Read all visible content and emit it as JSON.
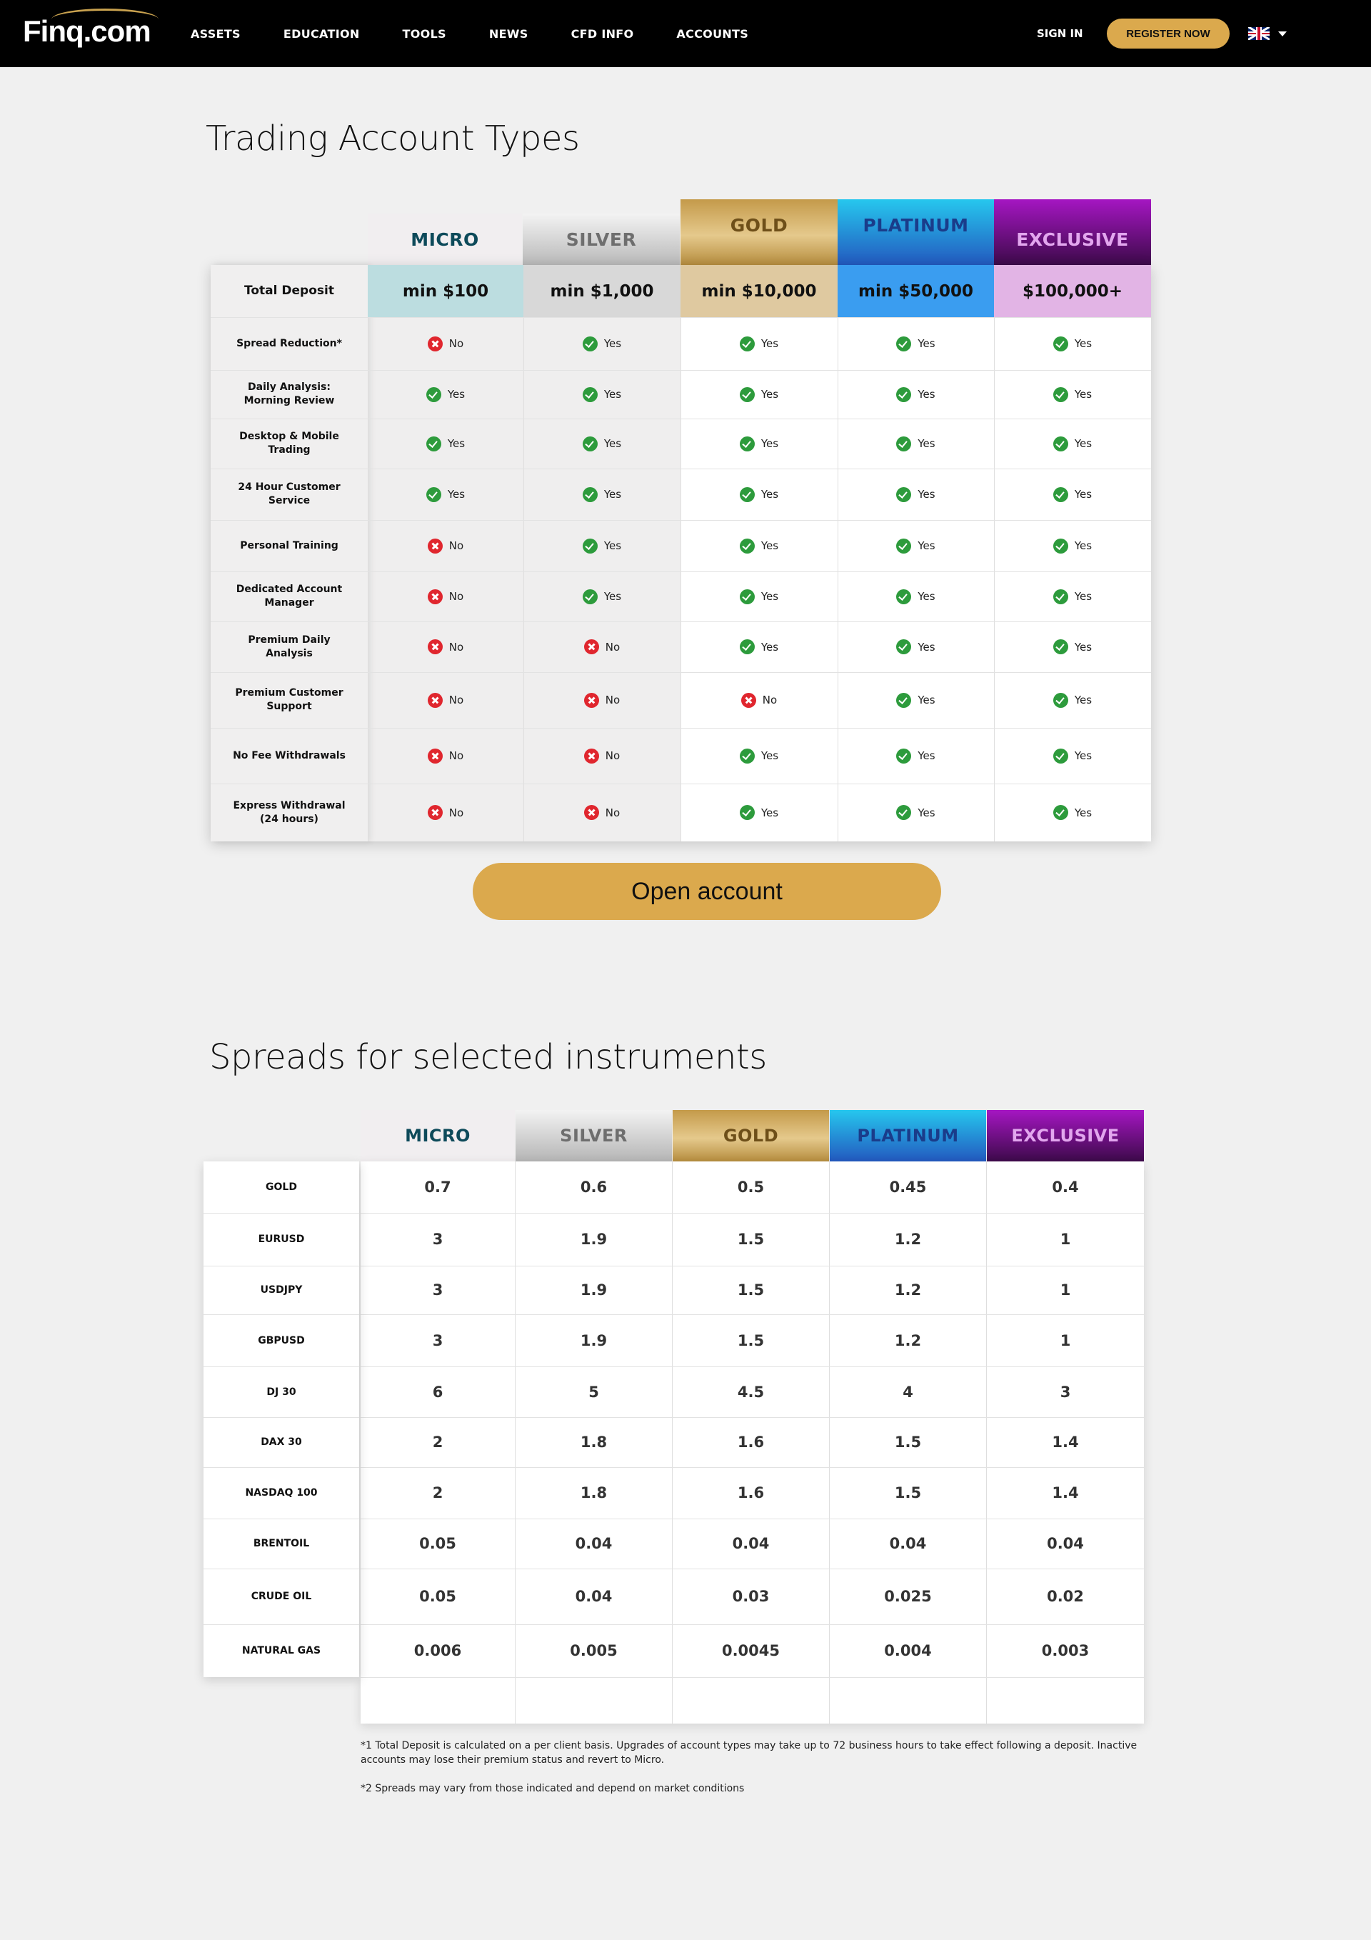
{
  "nav": {
    "logo": "Finq.com",
    "menu": [
      "ASSETS",
      "EDUCATION",
      "TOOLS",
      "NEWS",
      "CFD INFO",
      "ACCOUNTS"
    ],
    "sign_in": "SIGN IN",
    "register": "REGISTER NOW",
    "language_icon": "uk-flag-icon"
  },
  "accounts": {
    "title": "Trading Account Types",
    "tiers": [
      "MICRO",
      "SILVER",
      "GOLD",
      "PLATINUM",
      "EXCLUSIVE"
    ],
    "tier_colors": {
      "micro": "#f1eef0",
      "silver": "#b9b9b9",
      "gold": "#c49a4a",
      "platinum": "#2359bf",
      "exclusive": "#8a14a6"
    },
    "deposit_label": "Total Deposit",
    "deposits": [
      "min $100",
      "min $1,000",
      "min $10,000",
      "min $50,000",
      "$100,000+"
    ],
    "deposit_colors": [
      "#bcdde0",
      "#d8d8d8",
      "#dfc9a0",
      "#3a9df0",
      "#e2b4e5"
    ],
    "features": [
      {
        "label": "Spread Reduction*",
        "values": [
          "No",
          "Yes",
          "Yes",
          "Yes",
          "Yes"
        ]
      },
      {
        "label": "Daily Analysis: Morning Review",
        "values": [
          "Yes",
          "Yes",
          "Yes",
          "Yes",
          "Yes"
        ]
      },
      {
        "label": "Desktop & Mobile Trading",
        "values": [
          "Yes",
          "Yes",
          "Yes",
          "Yes",
          "Yes"
        ]
      },
      {
        "label": "24 Hour Customer Service",
        "values": [
          "Yes",
          "Yes",
          "Yes",
          "Yes",
          "Yes"
        ]
      },
      {
        "label": "Personal Training",
        "values": [
          "No",
          "Yes",
          "Yes",
          "Yes",
          "Yes"
        ]
      },
      {
        "label": "Dedicated Account Manager",
        "values": [
          "No",
          "Yes",
          "Yes",
          "Yes",
          "Yes"
        ]
      },
      {
        "label": "Premium Daily Analysis",
        "values": [
          "No",
          "No",
          "Yes",
          "Yes",
          "Yes"
        ]
      },
      {
        "label": "Premium Customer Support",
        "values": [
          "No",
          "No",
          "No",
          "Yes",
          "Yes"
        ]
      },
      {
        "label": "No Fee Withdrawals",
        "values": [
          "No",
          "No",
          "Yes",
          "Yes",
          "Yes"
        ]
      },
      {
        "label": "Express Withdrawal (24 hours)",
        "values": [
          "No",
          "No",
          "Yes",
          "Yes",
          "Yes"
        ]
      }
    ],
    "open_account": "Open account"
  },
  "spreads": {
    "title": "Spreads for selected instruments",
    "tiers": [
      "MICRO",
      "SILVER",
      "GOLD",
      "PLATINUM",
      "EXCLUSIVE"
    ],
    "rows": [
      {
        "label": "GOLD",
        "values": [
          "0.7",
          "0.6",
          "0.5",
          "0.45",
          "0.4"
        ]
      },
      {
        "label": "EURUSD",
        "values": [
          "3",
          "1.9",
          "1.5",
          "1.2",
          "1"
        ]
      },
      {
        "label": "USDJPY",
        "values": [
          "3",
          "1.9",
          "1.5",
          "1.2",
          "1"
        ]
      },
      {
        "label": "GBPUSD",
        "values": [
          "3",
          "1.9",
          "1.5",
          "1.2",
          "1"
        ]
      },
      {
        "label": "DJ 30",
        "values": [
          "6",
          "5",
          "4.5",
          "4",
          "3"
        ]
      },
      {
        "label": "DAX 30",
        "values": [
          "2",
          "1.8",
          "1.6",
          "1.5",
          "1.4"
        ]
      },
      {
        "label": "NASDAQ 100",
        "values": [
          "2",
          "1.8",
          "1.6",
          "1.5",
          "1.4"
        ]
      },
      {
        "label": "BRENTOIL",
        "values": [
          "0.05",
          "0.04",
          "0.04",
          "0.04",
          "0.04"
        ]
      },
      {
        "label": "CRUDE OIL",
        "values": [
          "0.05",
          "0.04",
          "0.03",
          "0.025",
          "0.02"
        ]
      },
      {
        "label": "NATURAL GAS",
        "values": [
          "0.006",
          "0.005",
          "0.0045",
          "0.004",
          "0.003"
        ]
      }
    ]
  },
  "footnotes": [
    "*1 Total Deposit is calculated on a per client basis. Upgrades of account types may take up to 72 business hours to take effect following a deposit. Inactive accounts may lose their premium status and revert to Micro.",
    "*2 Spreads may vary from those indicated and depend on market conditions"
  ]
}
